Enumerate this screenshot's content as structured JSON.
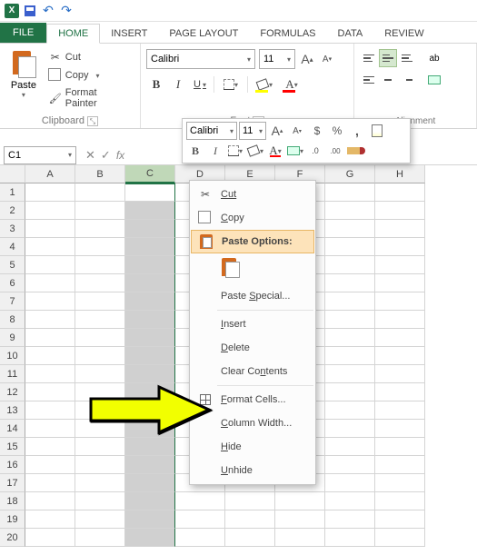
{
  "qat": {
    "app": "X"
  },
  "tabs": {
    "file": "FILE",
    "home": "HOME",
    "insert": "INSERT",
    "page": "PAGE LAYOUT",
    "formulas": "FORMULAS",
    "data": "DATA",
    "review": "REVIEW"
  },
  "clipboard": {
    "label": "Clipboard",
    "paste": "Paste",
    "cut": "Cut",
    "copy": "Copy",
    "painter": "Format Painter"
  },
  "font": {
    "label": "Font",
    "name": "Calibri",
    "size": "11",
    "B": "B",
    "I": "I",
    "U": "U",
    "A": "A"
  },
  "alignment": {
    "label": "Alignment"
  },
  "namebox": {
    "value": "C1"
  },
  "columns": [
    "A",
    "B",
    "C",
    "D",
    "E",
    "F",
    "G",
    "H"
  ],
  "selected_column_index": 2,
  "rows": [
    1,
    2,
    3,
    4,
    5,
    6,
    7,
    8,
    9,
    10,
    11,
    12,
    13,
    14,
    15,
    16,
    17,
    18,
    19,
    20
  ],
  "mini": {
    "font": "Calibri",
    "size": "11",
    "B": "B",
    "I": "I",
    "A": "A"
  },
  "context": {
    "cut": "Cut",
    "copy": "Copy",
    "paste_options": "Paste Options:",
    "paste_special": "Paste Special...",
    "insert": "Insert",
    "delete": "Delete",
    "clear": "Clear Contents",
    "format": "Format Cells...",
    "colwidth": "Column Width...",
    "hide": "Hide",
    "unhide": "Unhide"
  }
}
